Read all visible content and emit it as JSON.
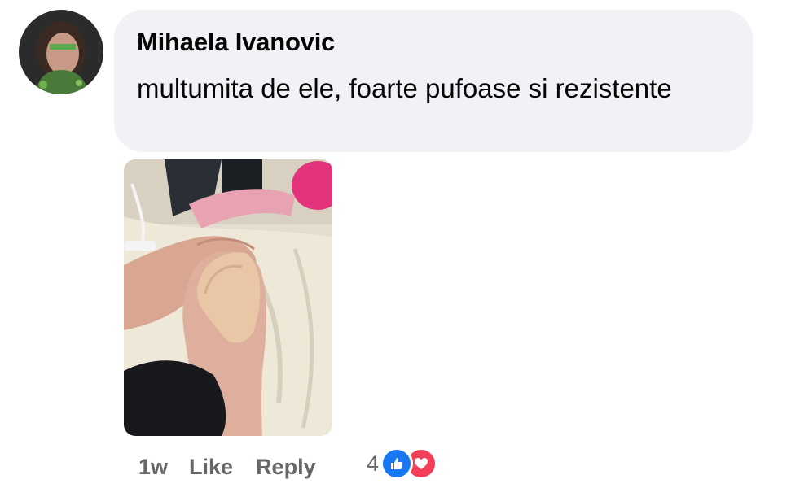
{
  "comment": {
    "author": "Mihaela Ivanovic",
    "text": "multumita de ele, foarte pufoase si rezistente",
    "timestamp": "1w",
    "like_label": "Like",
    "reply_label": "Reply",
    "reaction_count": "4",
    "reactions": [
      "like-icon",
      "love-icon"
    ],
    "photo": "image"
  },
  "colors": {
    "bubble": "#f0f2f5",
    "meta_text": "#65676b",
    "like": "#1877f2",
    "love": "#f33e58"
  }
}
